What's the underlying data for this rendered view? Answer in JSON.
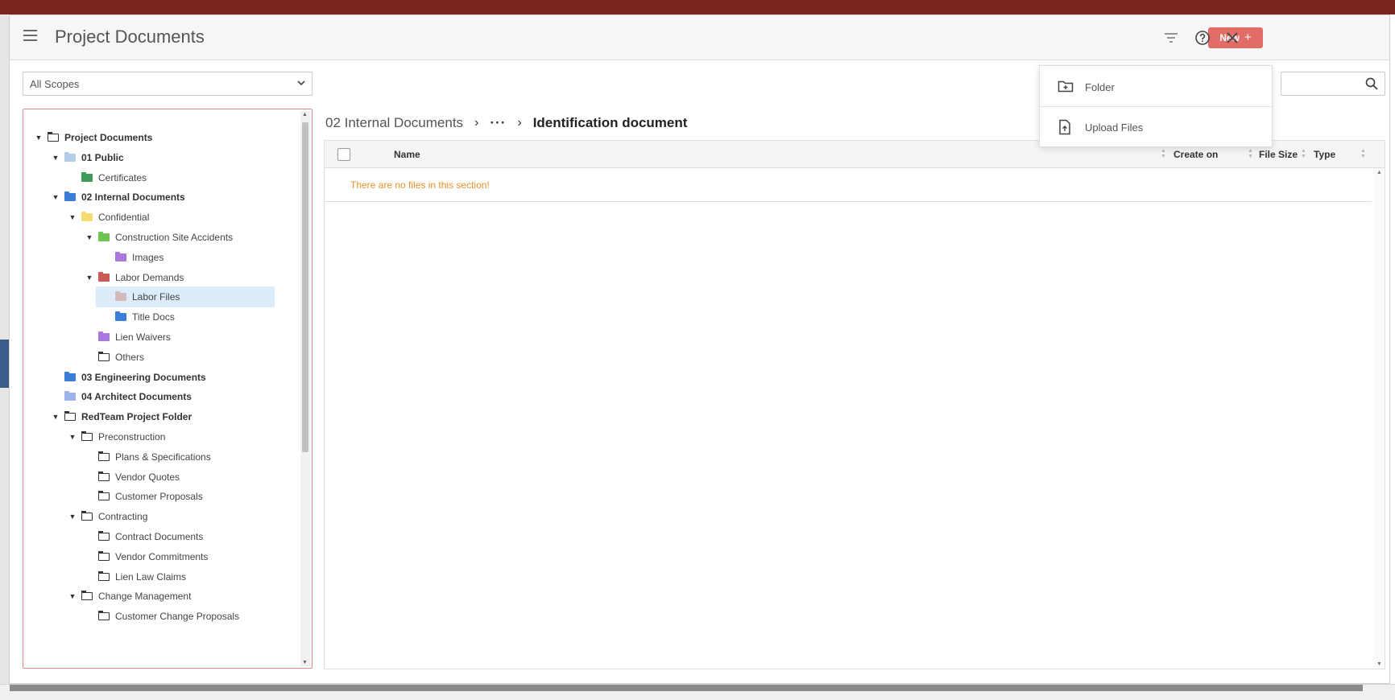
{
  "header": {
    "title": "Project Documents",
    "new_label": "New"
  },
  "scope_select": {
    "value": "All Scopes"
  },
  "tree": [
    {
      "label": "Project Documents",
      "caret": "▼",
      "icon": "outline",
      "bold": true
    },
    {
      "label": "01 Public",
      "caret": "▼",
      "icon": "#b6cde9",
      "bold": true
    },
    {
      "label": "Certificates",
      "caret": "",
      "icon": "#3f9a57",
      "bold": false
    },
    {
      "label": "02 Internal Documents",
      "caret": "▼",
      "icon": "#3a7ed8",
      "bold": true
    },
    {
      "label": "Confidential",
      "caret": "▼",
      "icon": "#f4dc72",
      "bold": false
    },
    {
      "label": "Construction Site Accidents",
      "caret": "▼",
      "icon": "#6ec450",
      "bold": false
    },
    {
      "label": "Images",
      "caret": "",
      "icon": "#a978dd",
      "bold": false
    },
    {
      "label": "Labor Demands",
      "caret": "▼",
      "icon": "#c95b56",
      "bold": false
    },
    {
      "label": "Labor Files",
      "caret": "",
      "icon": "#d3b9b9",
      "bold": false,
      "selected": true
    },
    {
      "label": "Title Docs",
      "caret": "",
      "icon": "#3a7ed8",
      "bold": false
    },
    {
      "label": "Lien Waivers",
      "caret": "",
      "icon": "#a978dd",
      "bold": false
    },
    {
      "label": "Others",
      "caret": "",
      "icon": "outline",
      "bold": false
    },
    {
      "label": "03 Engineering Documents",
      "caret": "",
      "icon": "#3a7ed8",
      "bold": true
    },
    {
      "label": "04 Architect Documents",
      "caret": "",
      "icon": "#9db1ea",
      "bold": true
    },
    {
      "label": "RedTeam Project Folder",
      "caret": "▼",
      "icon": "outline",
      "bold": true
    },
    {
      "label": "Preconstruction",
      "caret": "▼",
      "icon": "outline",
      "bold": false
    },
    {
      "label": "Plans & Specifications",
      "caret": "",
      "icon": "outline",
      "bold": false
    },
    {
      "label": "Vendor Quotes",
      "caret": "",
      "icon": "outline",
      "bold": false
    },
    {
      "label": "Customer Proposals",
      "caret": "",
      "icon": "outline",
      "bold": false
    },
    {
      "label": "Contracting",
      "caret": "▼",
      "icon": "outline",
      "bold": false
    },
    {
      "label": "Contract Documents",
      "caret": "",
      "icon": "outline",
      "bold": false
    },
    {
      "label": "Vendor Commitments",
      "caret": "",
      "icon": "outline",
      "bold": false
    },
    {
      "label": "Lien Law Claims",
      "caret": "",
      "icon": "outline",
      "bold": false
    },
    {
      "label": "Change Management",
      "caret": "▼",
      "icon": "outline",
      "bold": false
    },
    {
      "label": "Customer Change Proposals",
      "caret": "",
      "icon": "outline",
      "bold": false
    }
  ],
  "breadcrumb": {
    "first": "02 Internal Documents",
    "ellipsis": "···",
    "current": "Identification document"
  },
  "table": {
    "columns": {
      "name": "Name",
      "created": "Create on",
      "size": "File Size",
      "type": "Type"
    },
    "empty_message": "There are no files in this section!"
  },
  "new_menu": {
    "folder": "Folder",
    "upload": "Upload Files"
  },
  "colors": {
    "accent": "#e26d66",
    "empty_text": "#e8912b",
    "selection": "#dcecfb"
  }
}
